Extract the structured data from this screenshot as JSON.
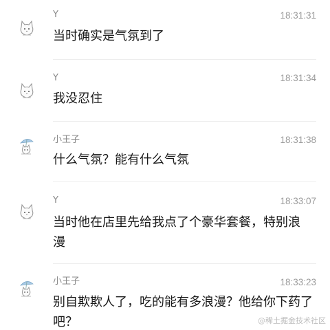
{
  "messages": [
    {
      "sender": "Y",
      "time": "18:31:31",
      "text": "当时确实是气氛到了",
      "avatar_icon": "cat-avatar-icon"
    },
    {
      "sender": "Y",
      "time": "18:31:34",
      "text": "我没忍住",
      "avatar_icon": "cat-avatar-icon"
    },
    {
      "sender": "小王子",
      "time": "18:31:38",
      "text": "什么气氛？能有什么气氛",
      "avatar_icon": "umbrella-cat-avatar-icon"
    },
    {
      "sender": "Y",
      "time": "18:33:07",
      "text": "当时他在店里先给我点了个豪华套餐，特别浪漫",
      "avatar_icon": "cat-avatar-icon"
    },
    {
      "sender": "小王子",
      "time": "18:33:23",
      "text": "别自欺欺人了，吃的能有多浪漫？他给你下药了吧？",
      "avatar_icon": "umbrella-cat-avatar-icon"
    }
  ],
  "watermark": "@稀土掘金技术社区",
  "colors": {
    "text": "#1a1a1a",
    "meta": "#8a8a8a",
    "umbrella": "#a9cbe6"
  }
}
